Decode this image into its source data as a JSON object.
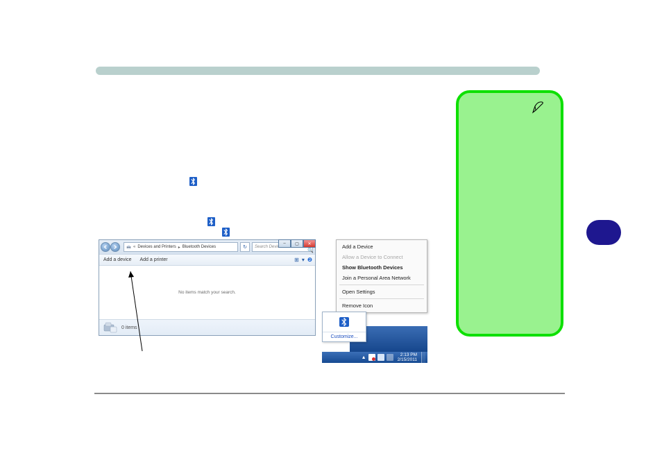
{
  "explorer": {
    "breadcrumb": {
      "seg1": "Devices and Printers",
      "seg2": "Bluetooth Devices"
    },
    "search_placeholder": "Search Devices and Printers",
    "toolbar": {
      "add_device": "Add a device",
      "add_printer": "Add a printer"
    },
    "body_message": "No items match your search.",
    "status_count": "0 items"
  },
  "context_menu": {
    "add_device": "Add a Device",
    "allow_connect": "Allow a Device to Connect",
    "show_devices": "Show Bluetooth Devices",
    "join_pan": "Join a Personal Area Network",
    "open_settings": "Open Settings",
    "remove_icon": "Remove Icon"
  },
  "tray": {
    "customize": "Customize...",
    "clock_time": "2:13 PM",
    "clock_date": "2/15/2011"
  },
  "icons": {
    "bluetooth": "bluetooth-icon",
    "pen": "pen-icon"
  }
}
